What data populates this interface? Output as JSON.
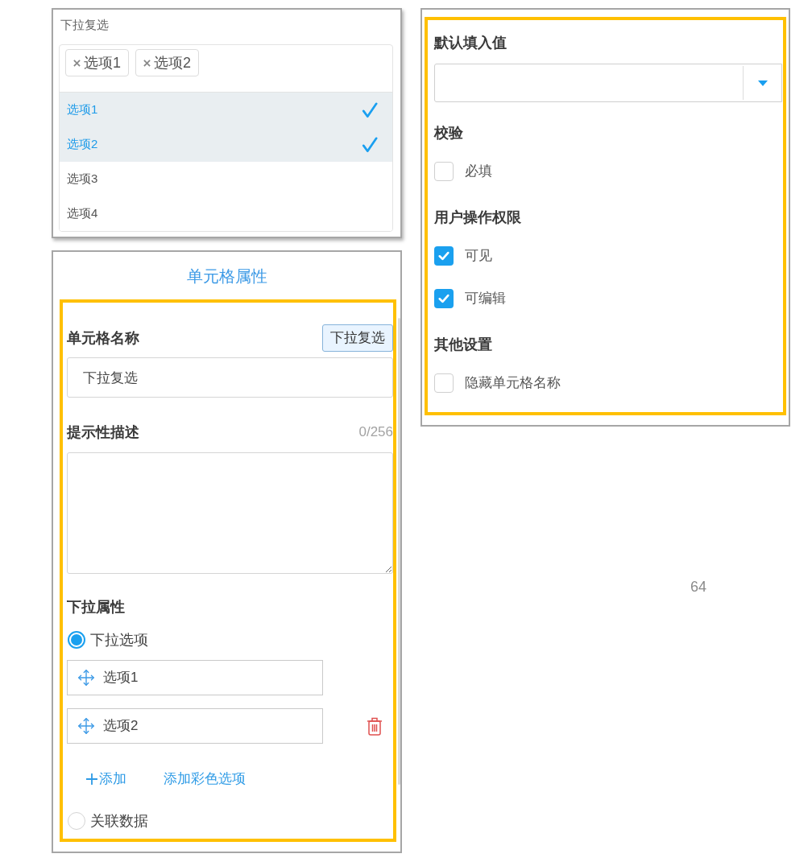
{
  "dropdown_preview": {
    "title": "下拉复选",
    "tags": [
      {
        "label": "选项1"
      },
      {
        "label": "选项2"
      }
    ],
    "options": [
      {
        "label": "选项1",
        "selected": true
      },
      {
        "label": "选项2",
        "selected": true
      },
      {
        "label": "选项3",
        "selected": false
      },
      {
        "label": "选项4",
        "selected": false
      }
    ]
  },
  "cell_properties": {
    "title": "单元格属性",
    "name": {
      "label": "单元格名称",
      "type_button": "下拉复选",
      "value": "下拉复选"
    },
    "description": {
      "label": "提示性描述",
      "counter": "0/256"
    },
    "dropdown_properties": {
      "label": "下拉属性",
      "choices": [
        {
          "kind": "options",
          "label": "下拉选项",
          "selected": true,
          "options": [
            {
              "value": "选项1",
              "delete_visible": false
            },
            {
              "value": "选项2",
              "delete_visible": true
            }
          ],
          "actions": [
            {
              "kind": "add",
              "label": "添加"
            },
            {
              "kind": "add_color",
              "label": "添加彩色选项"
            }
          ]
        },
        {
          "kind": "linked",
          "label": "关联数据",
          "selected": false
        }
      ]
    }
  },
  "settings": {
    "sections": [
      {
        "kind": "select",
        "label": "默认填入值"
      },
      {
        "kind": "checks",
        "label": "校验",
        "items": [
          {
            "label": "必填",
            "checked": false
          }
        ]
      },
      {
        "kind": "checks",
        "label": "用户操作权限",
        "items": [
          {
            "label": "可见",
            "checked": true
          },
          {
            "label": "可编辑",
            "checked": true
          }
        ]
      },
      {
        "kind": "checks",
        "label": "其他设置",
        "items": [
          {
            "label": "隐藏单元格名称",
            "checked": false
          }
        ]
      }
    ]
  },
  "page_number": "64"
}
